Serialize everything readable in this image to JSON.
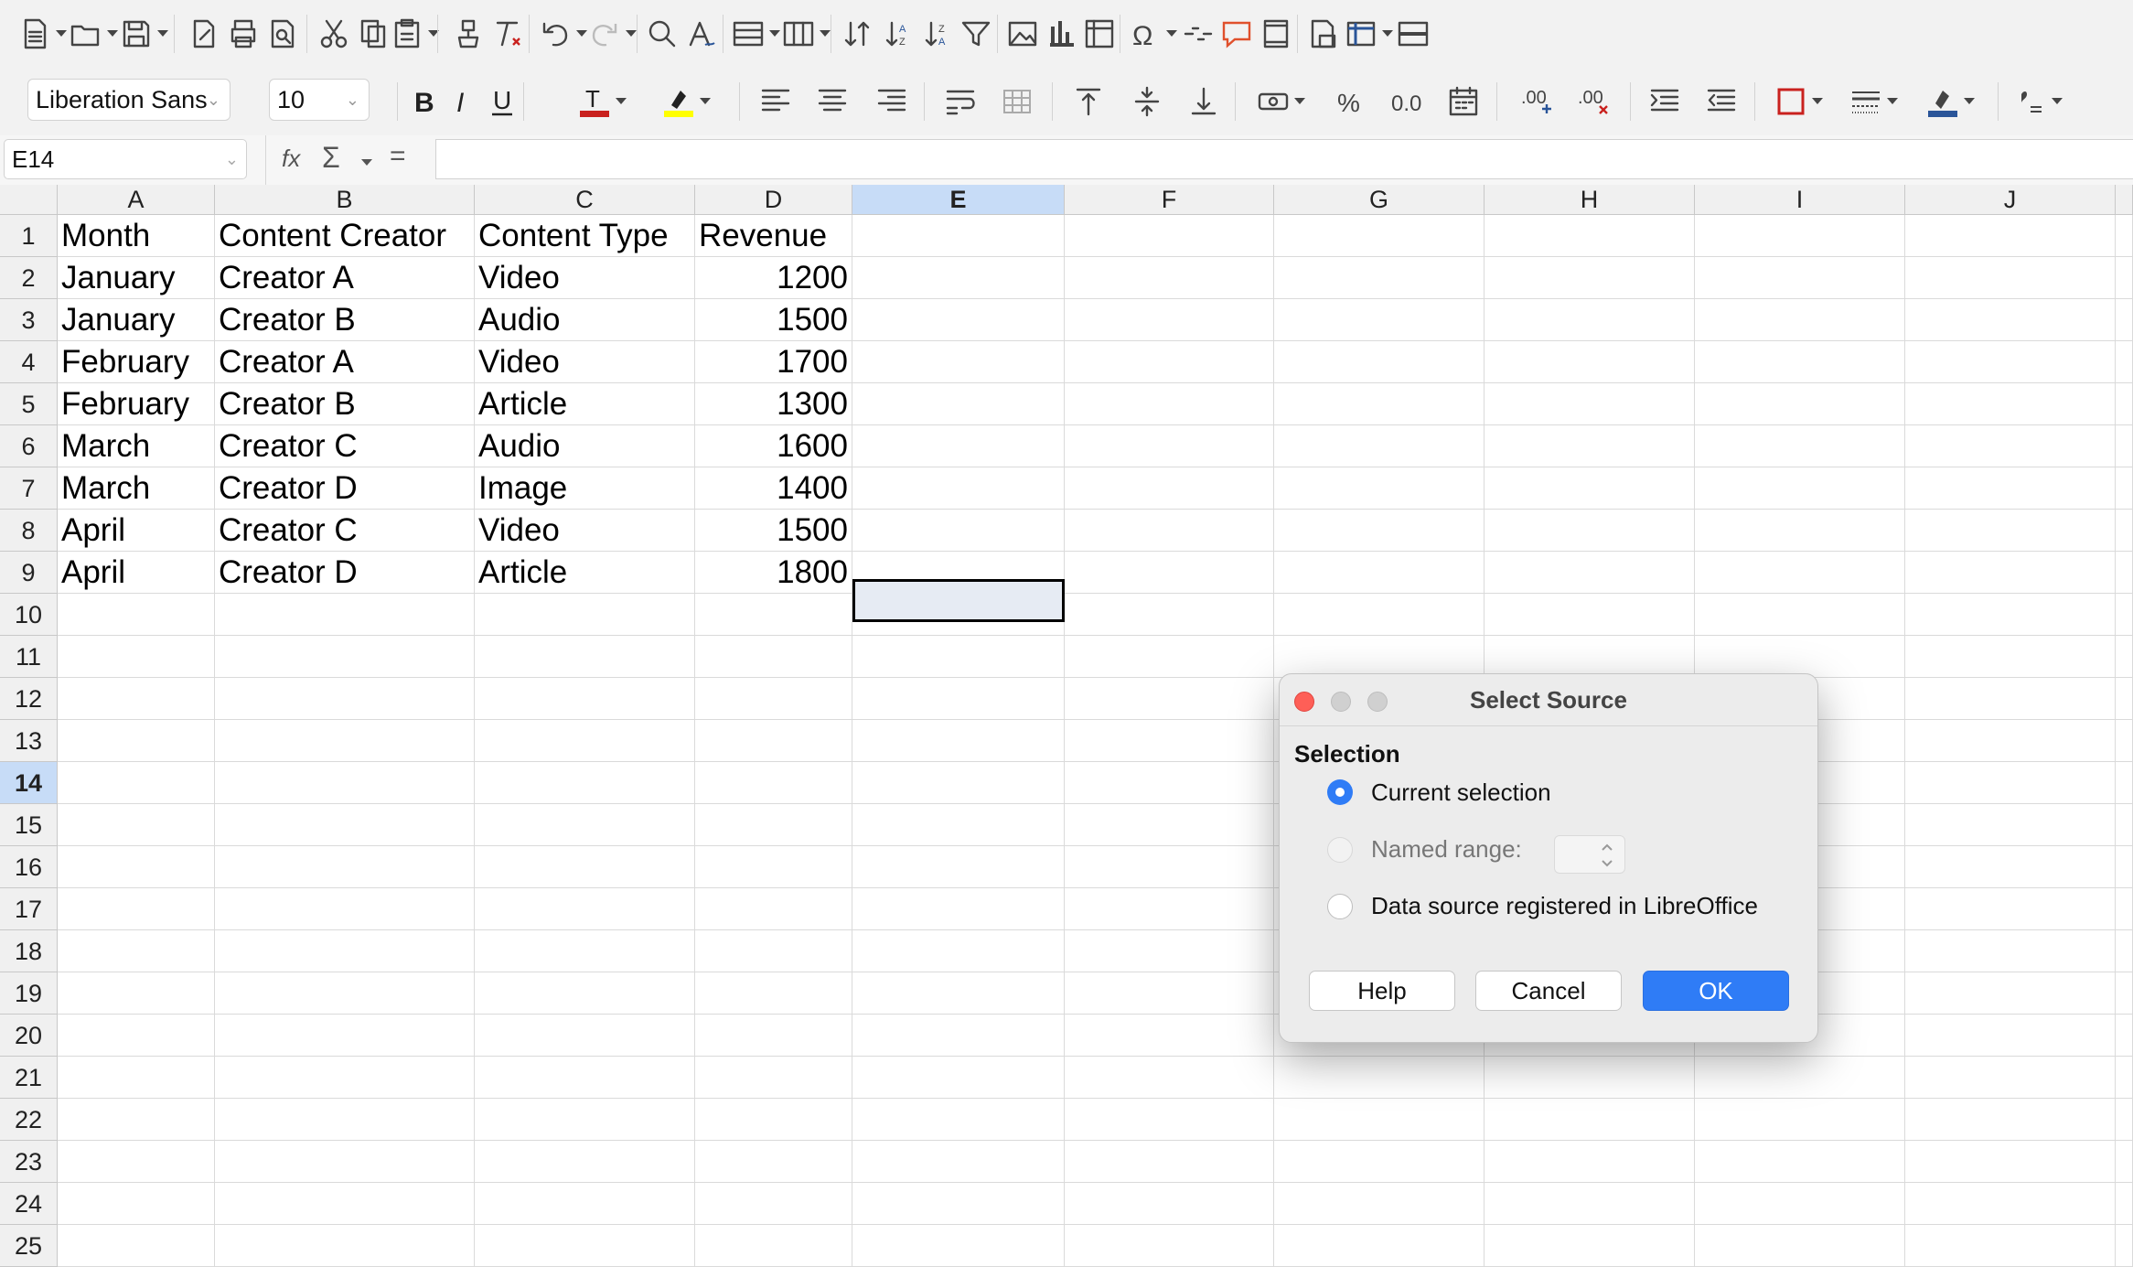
{
  "toolbar": {
    "font_name": "Liberation Sans",
    "font_size": "10",
    "icons": [
      "new-document",
      "open",
      "save",
      "toggle-edit-mode",
      "print",
      "print-preview",
      "cut",
      "copy",
      "paste",
      "clone-formatting",
      "clear-formatting",
      "undo",
      "redo",
      "find-replace",
      "spelling",
      "row",
      "column",
      "sort",
      "sort-ascending",
      "sort-descending",
      "autofilter",
      "insert-image",
      "insert-chart",
      "insert-pivot-table",
      "special-character",
      "hyperlink",
      "comment",
      "headers-footers",
      "define-print-area",
      "freeze-rows-columns",
      "split-window",
      "bold",
      "italic",
      "underline",
      "font-color",
      "highlight-color",
      "align-left",
      "align-center",
      "align-right",
      "wrap-text",
      "merge-cells",
      "align-top",
      "center-vertically",
      "align-bottom",
      "format-as-currency",
      "format-as-percent",
      "format-as-number",
      "format-as-date",
      "add-decimal-place",
      "delete-decimal-place",
      "increase-indent",
      "decrease-indent",
      "borders",
      "border-style",
      "border-color",
      "conditional-format"
    ],
    "colors": {
      "font_color_bar": "#c9211e",
      "highlight_bar": "#ffff00",
      "border_color_bar": "#2a5599"
    }
  },
  "formula_bar": {
    "cell_ref": "E14",
    "function_wizard": "fx",
    "sum_symbol": "Σ",
    "equals_symbol": "=",
    "content": ""
  },
  "sheet": {
    "columns": [
      "A",
      "B",
      "C",
      "D",
      "E",
      "F",
      "G",
      "H",
      "I",
      "J"
    ],
    "selected_column": "E",
    "selected_row": "14",
    "row_numbers": [
      "1",
      "2",
      "3",
      "4",
      "5",
      "6",
      "7",
      "8",
      "9",
      "10",
      "11",
      "12",
      "13",
      "14",
      "15",
      "16",
      "17",
      "18",
      "19",
      "20",
      "21",
      "22",
      "23",
      "24",
      "25"
    ],
    "rows": [
      [
        "Month",
        "Content Creator",
        "Content Type",
        "Revenue"
      ],
      [
        "January",
        "Creator A",
        "Video",
        "1200"
      ],
      [
        "January",
        "Creator B",
        "Audio",
        "1500"
      ],
      [
        "February",
        "Creator A",
        "Video",
        "1700"
      ],
      [
        "February",
        "Creator B",
        "Article",
        "1300"
      ],
      [
        "March",
        "Creator C",
        "Audio",
        "1600"
      ],
      [
        "March",
        "Creator D",
        "Image",
        "1400"
      ],
      [
        "April",
        "Creator C",
        "Video",
        "1500"
      ],
      [
        "April",
        "Creator D",
        "Article",
        "1800"
      ]
    ]
  },
  "dialog": {
    "title": "Select Source",
    "section": "Selection",
    "options": [
      {
        "label": "Current selection",
        "selected": true,
        "enabled": true
      },
      {
        "label": "Named range:",
        "selected": false,
        "enabled": false
      },
      {
        "label": "Data source registered in LibreOffice",
        "selected": false,
        "enabled": true
      }
    ],
    "buttons": {
      "help": "Help",
      "cancel": "Cancel",
      "ok": "OK"
    },
    "traffic_lights": {
      "close": "#fe5f57",
      "minimize": "#d0d0d0",
      "zoom": "#d0d0d0"
    },
    "accent": "#2f7cf6"
  }
}
